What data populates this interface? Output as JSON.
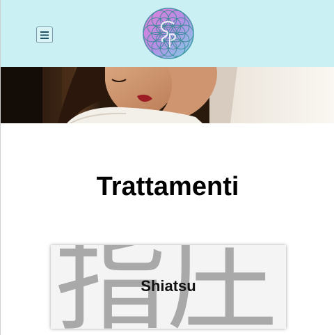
{
  "header": {
    "background_color": "#cbf0f3",
    "menu_icon": "hamburger-menu-icon",
    "logo_icon": "flower-of-life-logo-icon"
  },
  "hero": {
    "image": "woman-relaxing-massage-photo"
  },
  "main": {
    "title": "Trattamenti",
    "cards": [
      {
        "label": "Shiatsu",
        "background_text": "指圧"
      }
    ]
  }
}
